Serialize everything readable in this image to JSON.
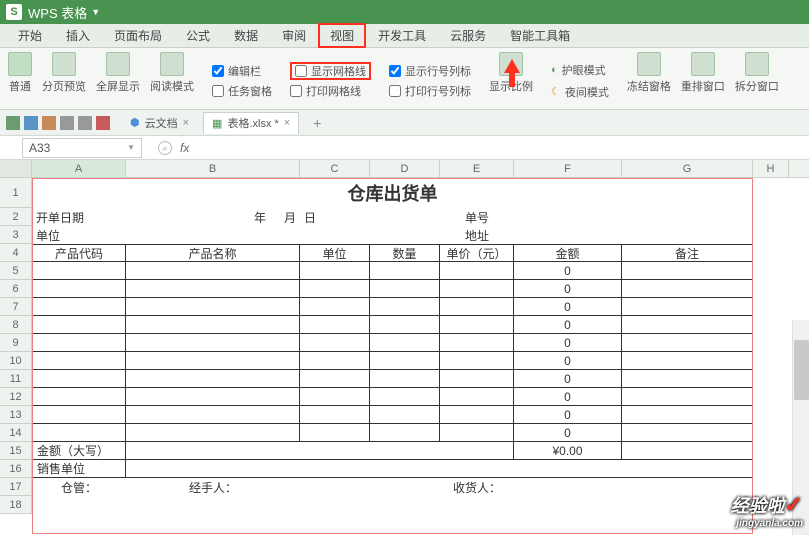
{
  "app": {
    "name": "WPS 表格"
  },
  "menu": [
    "开始",
    "插入",
    "页面布局",
    "公式",
    "数据",
    "审阅",
    "视图",
    "开发工具",
    "云服务",
    "智能工具箱"
  ],
  "menu_highlight_index": 6,
  "ribbon": {
    "view_modes": [
      "普通",
      "分页预览",
      "全屏显示",
      "阅读模式"
    ],
    "checks_col1": [
      {
        "label": "编辑栏",
        "checked": true
      },
      {
        "label": "任务窗格",
        "checked": false
      }
    ],
    "checks_col2": [
      {
        "label": "显示网格线",
        "checked": false,
        "highlight": true
      },
      {
        "label": "打印网格线",
        "checked": false
      }
    ],
    "checks_col3": [
      {
        "label": "显示行号列标",
        "checked": true
      },
      {
        "label": "打印行号列标",
        "checked": false
      }
    ],
    "zoom": "显示比例",
    "modes2": [
      "护眼模式",
      "夜间模式"
    ],
    "window": [
      "冻结窗格",
      "重排窗口",
      "拆分窗口"
    ]
  },
  "tabs": {
    "cloud": "云文档",
    "file": "表格.xlsx *",
    "plus": "+"
  },
  "namebox": "A33",
  "fx": "fx",
  "columns": [
    "A",
    "B",
    "C",
    "D",
    "E",
    "F",
    "G",
    "H"
  ],
  "sheet": {
    "title": "仓库出货单",
    "r2": {
      "c1": "开单日期",
      "c2": "年",
      "c3": "月",
      "c4": "日",
      "c5": "单号"
    },
    "r3": {
      "c1": "单位",
      "c5": "地址"
    },
    "hdr": [
      "产品代码",
      "产品名称",
      "单位",
      "数量",
      "单价（元）",
      "金额",
      "备注"
    ],
    "zero": "0",
    "r15": {
      "label": "金额（大写）",
      "val": "¥0.00"
    },
    "r16": "销售单位",
    "r17": {
      "a": "仓管：",
      "b": "经手人：",
      "c": "收货人："
    }
  },
  "watermark": {
    "line1": "经验啦",
    "line2": "jingyanla.com"
  }
}
